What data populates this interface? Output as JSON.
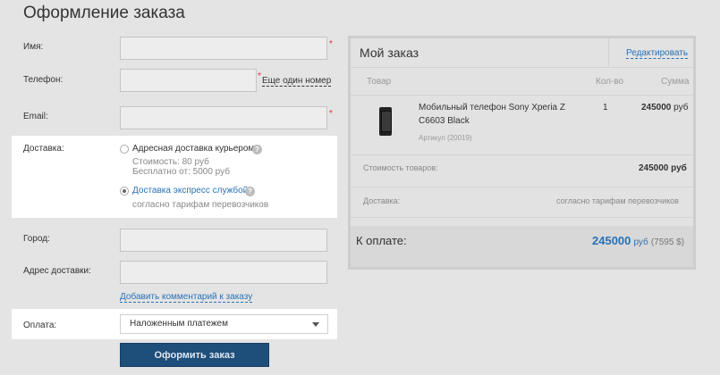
{
  "page": {
    "title": "Оформление заказа"
  },
  "form": {
    "name_label": "Имя:",
    "phone_label": "Телефон:",
    "another_phone_link": "Еще один номер",
    "email_label": "Email:",
    "delivery_label": "Доставка:",
    "delivery_options": [
      {
        "label": "Адресная доставка курьером",
        "details": [
          "Стоимость: 80 руб",
          "Бесплатно от: 5000 руб"
        ],
        "selected": false
      },
      {
        "label": "Доставка экспресс службой",
        "details": [
          "согласно тарифам перевозчиков"
        ],
        "selected": true
      }
    ],
    "city_label": "Город:",
    "address_label": "Адрес доставки:",
    "add_comment_link": "Добавить комментарий к заказу",
    "payment_label": "Оплата:",
    "payment_value": "Наложенным платежем",
    "submit_label": "Оформить заказ",
    "required_mark": "*",
    "help_mark": "?"
  },
  "order": {
    "title": "Мой заказ",
    "edit_link": "Редактировать",
    "columns": {
      "product": "Товар",
      "qty": "Кол-во",
      "sum": "Сумма"
    },
    "item": {
      "name_line1": "Мобильный телефон Sony Xperia Z",
      "name_line2": "C6603 Black",
      "article": "Артикул (20019)",
      "qty": "1",
      "sum": "245000",
      "currency": "руб"
    },
    "goods_cost_label": "Стоимость товаров:",
    "goods_cost_value": "245000 руб",
    "delivery_label": "Доставка:",
    "delivery_value": "согласно тарифам перевозчиков",
    "total_label": "К оплате:",
    "total_value": "245000",
    "total_currency": "руб",
    "total_usd": "(7595 $)"
  },
  "colors": {
    "accent_blue": "#2a72b5",
    "button_bg": "#1e4e7a",
    "required_red": "#e0303a"
  }
}
